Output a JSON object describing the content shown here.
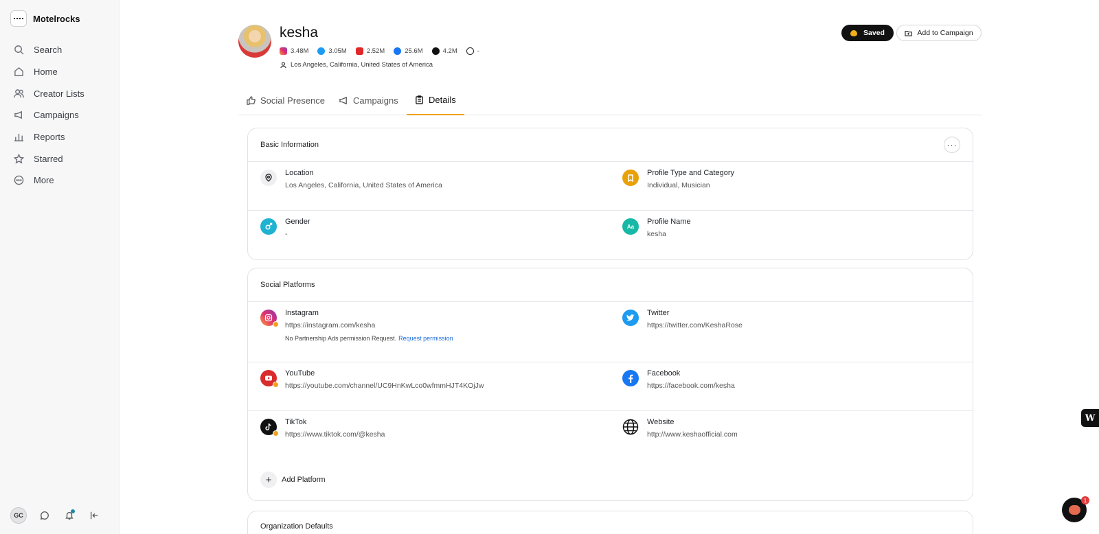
{
  "app": {
    "name": "Motelrocks"
  },
  "nav": {
    "items": [
      {
        "label": "Search",
        "icon": "search-icon"
      },
      {
        "label": "Home",
        "icon": "home-icon"
      },
      {
        "label": "Creator Lists",
        "icon": "users-icon"
      },
      {
        "label": "Campaigns",
        "icon": "megaphone-icon"
      },
      {
        "label": "Reports",
        "icon": "bar-chart-icon"
      },
      {
        "label": "Starred",
        "icon": "star-icon"
      },
      {
        "label": "More",
        "icon": "more-circle-icon"
      }
    ]
  },
  "user": {
    "initials": "GC"
  },
  "profile": {
    "name": "kesha",
    "location": "Los Angeles, California, United States of America",
    "stats": {
      "instagram": "3.48M",
      "twitter": "3.05M",
      "youtube": "2.52M",
      "facebook": "25.6M",
      "tiktok": "4.2M",
      "website": "-"
    }
  },
  "actions": {
    "saved": "Saved",
    "add_to_campaign": "Add to Campaign"
  },
  "tabs": [
    {
      "label": "Social Presence"
    },
    {
      "label": "Campaigns"
    },
    {
      "label": "Details"
    }
  ],
  "basic_info": {
    "title": "Basic Information",
    "location_label": "Location",
    "location_value": "Los Angeles, California, United States of America",
    "profile_type_label": "Profile Type and Category",
    "profile_type_value": "Individual, Musician",
    "gender_label": "Gender",
    "gender_value": "-",
    "profile_name_label": "Profile Name",
    "profile_name_value": "kesha",
    "profile_name_badge": "Aa"
  },
  "social": {
    "title": "Social Platforms",
    "instagram_label": "Instagram",
    "instagram_url": "https://instagram.com/kesha",
    "instagram_note": "No Partnership Ads permission Request.",
    "instagram_link": "Request permission",
    "twitter_label": "Twitter",
    "twitter_url": "https://twitter.com/KeshaRose",
    "youtube_label": "YouTube",
    "youtube_url": "https://youtube.com/channel/UC9HnKwLco0wfmmHJT4KOjJw",
    "facebook_label": "Facebook",
    "facebook_url": "https://facebook.com/kesha",
    "tiktok_label": "TikTok",
    "tiktok_url": "https://www.tiktok.com/@kesha",
    "website_label": "Website",
    "website_url": "http://www.keshaofficial.com",
    "add_platform": "Add Platform"
  },
  "org_defaults": {
    "title": "Organization Defaults"
  },
  "floating": {
    "w_label": "W",
    "chat_count": "1"
  },
  "colors": {
    "accent": "#f2a11a",
    "link": "#1a6ad6",
    "saved_bg": "#111111"
  }
}
